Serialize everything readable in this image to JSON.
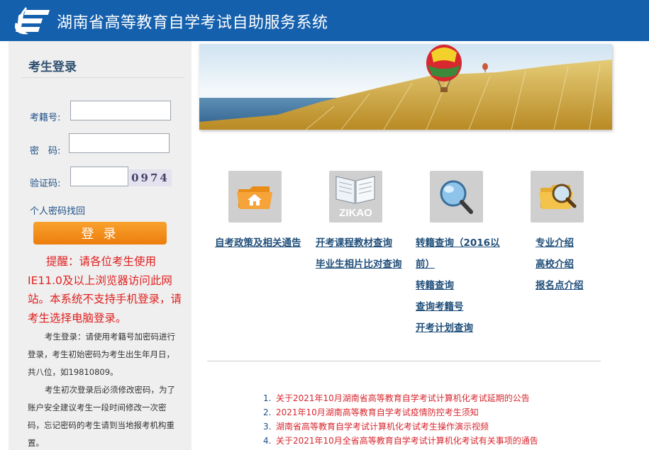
{
  "header": {
    "title": "湖南省高等教育自学考试自助服务系统"
  },
  "login": {
    "title": "考生登录",
    "id_label": "考籍号:",
    "pwd_label": "密　码:",
    "captcha_label": "验证码:",
    "captcha_text": "0974",
    "id_value": "",
    "pwd_value": "",
    "captcha_value": "",
    "forgot_link": "个人密码找回",
    "login_button": "登 录",
    "warning": "提醒：请各位考生使用IE11.0及以上浏览器访问此网站。本系统不支持手机登录，请考生选择电脑登录。",
    "note1": "考生登录：请使用考籍号加密码进行登录，考生初始密码为考生出生年月日，共八位，如19810809。",
    "note2": "考生初次登录后必须修改密码，为了账户安全建议考生一段时间修改一次密码，忘记密码的考生请到当地报考机构重置。"
  },
  "tiles": [
    {
      "icon": "folder-home-icon",
      "links": [
        "自考政策及相关通告"
      ]
    },
    {
      "icon": "zikao-book-icon",
      "icon_text": "ZIKAO",
      "links": [
        "开考课程教材查询",
        "毕业生相片比对查询"
      ]
    },
    {
      "icon": "magnifier-icon",
      "links": [
        "转籍查询（2016以",
        "前）",
        "转籍查询",
        "查询考籍号",
        "开考计划查询"
      ]
    },
    {
      "icon": "folder-search-icon",
      "links": [
        "专业介绍",
        "高校介绍",
        "报名点介绍"
      ]
    }
  ],
  "notices": [
    {
      "num": "1.",
      "text": "关于2021年10月湖南省高等教育自学考试计算机化考试延期的公告"
    },
    {
      "num": "2.",
      "text": "2021年10月湖南高等教育自学考试疫情防控考生须知"
    },
    {
      "num": "3.",
      "text": "湖南省高等教育自学考试计算机化考试考生操作演示视频"
    },
    {
      "num": "4.",
      "text": "关于2021年10月全省高等教育自学考试计算机化考试有关事项的通告"
    }
  ],
  "colors": {
    "header": "#1560ad",
    "sidebar": "#efefef",
    "button": "#f28b16",
    "warning": "#e0201f",
    "link": "#1f4e79",
    "notice": "#d8262e"
  }
}
